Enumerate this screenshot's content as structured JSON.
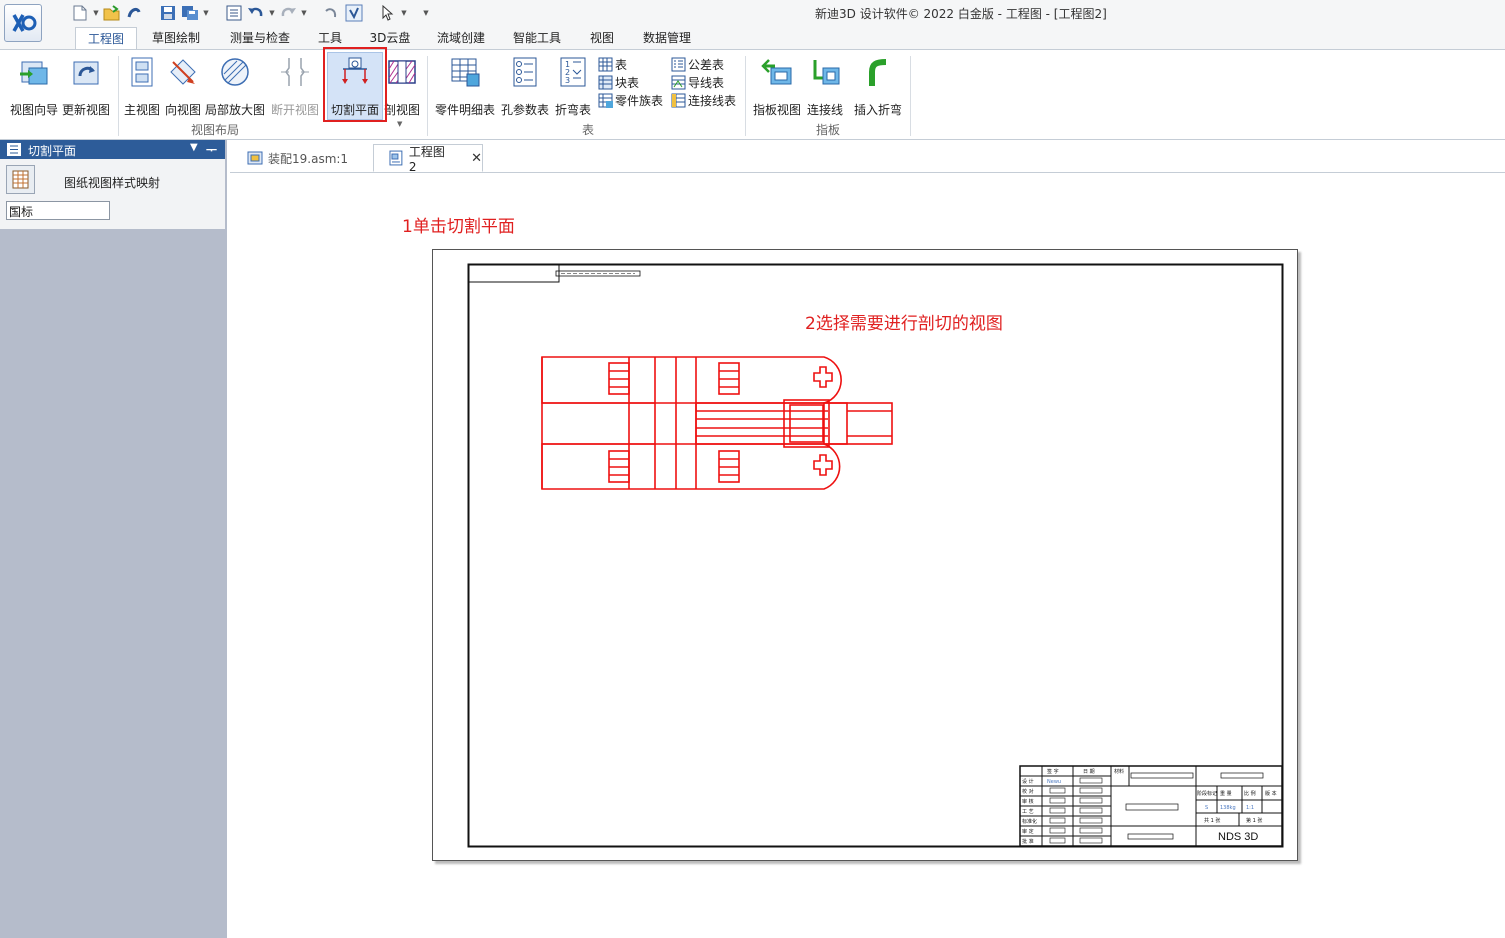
{
  "window": {
    "title": "新迪3D 设计软件© 2022 白金版 - 工程图 - [工程图2]"
  },
  "menu_tabs": [
    "工程图",
    "草图绘制",
    "测量与检查",
    "工具",
    "3D云盘",
    "流域创建",
    "智能工具",
    "视图",
    "数据管理"
  ],
  "ribbon": {
    "buttons": {
      "view_wizard": "视图向导",
      "update_view": "更新视图",
      "main_view": "主视图",
      "direction_view": "向视图",
      "detail_view": "局部放大图",
      "break_view": "断开视图",
      "cutting_plane": "切割平面",
      "section_view": "剖视图",
      "parts_list": "零件明细表",
      "hole_table": "孔参数表",
      "bend_table": "折弯表",
      "table": "表",
      "block_table": "块表",
      "part_family_table": "零件族表",
      "tolerance_table": "公差表",
      "wire_table": "导线表",
      "connector_table": "连接线表",
      "board_view": "指板视图",
      "connect_line": "连接线",
      "insert_bend": "插入折弯"
    },
    "groups": {
      "view_layout": "视图布局",
      "table": "表",
      "board": "指板"
    }
  },
  "left_panel": {
    "title": "切割平面",
    "mapping_label": "图纸视图样式映射",
    "standard_value": "国标"
  },
  "doc_tabs": [
    {
      "label": "装配19.asm:1",
      "active": false
    },
    {
      "label": "工程图2",
      "active": true
    }
  ],
  "annotations": {
    "step1": "1单击切割平面",
    "step2": "2选择需要进行剖切的视图"
  },
  "title_block": {
    "company": "NDS  3D",
    "headers": {
      "sign": "签 字",
      "date": "日 期",
      "material": "材料",
      "mark": "阶段标记",
      "weight": "重 量",
      "scale": "比 例",
      "version": "版 本"
    },
    "roles": [
      "设 计",
      "校 对",
      "审 核",
      "工 艺",
      "标准化",
      "审 定",
      "批 准"
    ],
    "designer": "Newu",
    "stage": "S",
    "weight_value": "138kg",
    "scale_value": "1:1",
    "sheets_total": "共 1 张",
    "sheet_no": "第 1 张"
  },
  "colors": {
    "accent": "#2b5797",
    "highlight": "#e02020",
    "view_line": "#ee1111",
    "panel_header": "#2d5c99",
    "panel_bg": "#b5bccb"
  }
}
